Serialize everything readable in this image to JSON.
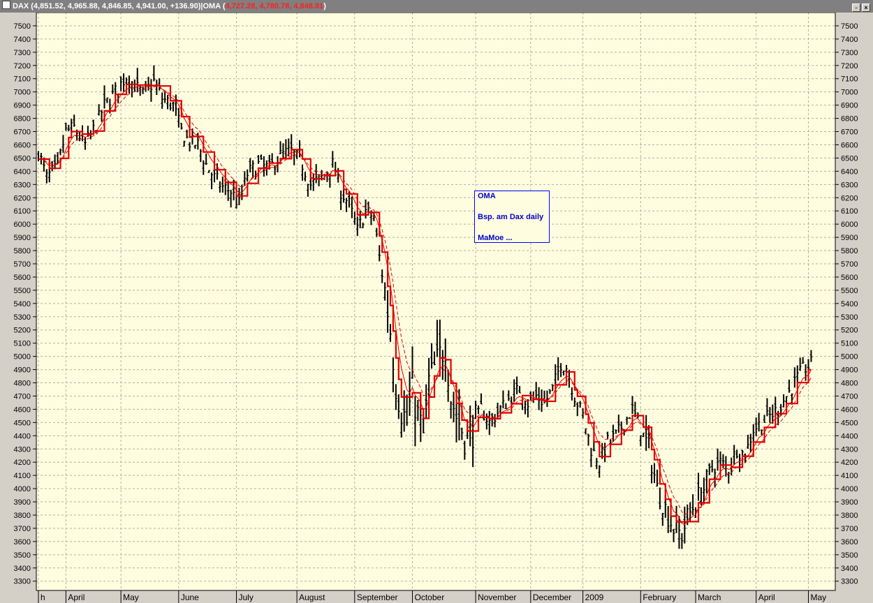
{
  "window": {
    "symbol": "DAX",
    "ohlc": "(4,851.52, 4,965.88, 4,846.85, 4,941.00, +136.90)",
    "indicator_name": "OMA",
    "indicator_open": "(",
    "indicator_values": "4,727.28, 4,780.78, 4,848.81",
    "indicator_close": ")",
    "buttons": [
      "restore",
      "close"
    ]
  },
  "annotation": {
    "line1": "OMA",
    "line2": "Bsp. am Dax daily",
    "line3": "MaMoe ..."
  },
  "colors": {
    "background": "#fffde0",
    "price_bars": "#000000",
    "oma": "#e00000",
    "annotation": "#0000cc"
  },
  "chart_data": {
    "type": "bar",
    "title": "",
    "xlabel": "",
    "ylabel": "",
    "ylim": [
      3230,
      7600
    ],
    "y_ticks": [
      3300,
      3400,
      3500,
      3600,
      3700,
      3800,
      3900,
      4000,
      4100,
      4200,
      4300,
      4400,
      4500,
      4600,
      4700,
      4800,
      4900,
      5000,
      5100,
      5200,
      5300,
      5400,
      5500,
      5600,
      5700,
      5800,
      5900,
      6000,
      6100,
      6200,
      6300,
      6400,
      6500,
      6600,
      6700,
      6800,
      6900,
      7000,
      7100,
      7200,
      7300,
      7400,
      7500
    ],
    "grid": true,
    "y_axis_both_sides": true,
    "month_labels": [
      {
        "label": "h",
        "day": 0
      },
      {
        "label": "April",
        "day": 10
      },
      {
        "label": "May",
        "day": 30
      },
      {
        "label": "June",
        "day": 51
      },
      {
        "label": "July",
        "day": 72
      },
      {
        "label": "August",
        "day": 94
      },
      {
        "label": "September",
        "day": 115
      },
      {
        "label": "October",
        "day": 136
      },
      {
        "label": "November",
        "day": 159
      },
      {
        "label": "December",
        "day": 179
      },
      {
        "label": "2009",
        "day": 198
      },
      {
        "label": "February",
        "day": 219
      },
      {
        "label": "March",
        "day": 239
      },
      {
        "label": "April",
        "day": 261
      },
      {
        "label": "May",
        "day": 280
      }
    ],
    "total_days": 288,
    "price_anchors": [
      [
        0,
        6550
      ],
      [
        3,
        6350
      ],
      [
        7,
        6430
      ],
      [
        10,
        6700
      ],
      [
        13,
        6730
      ],
      [
        17,
        6600
      ],
      [
        21,
        6750
      ],
      [
        24,
        6900
      ],
      [
        28,
        7000
      ],
      [
        32,
        7120
      ],
      [
        35,
        7050
      ],
      [
        38,
        6980
      ],
      [
        42,
        7080
      ],
      [
        45,
        6950
      ],
      [
        49,
        6900
      ],
      [
        52,
        6700
      ],
      [
        55,
        6620
      ],
      [
        58,
        6600
      ],
      [
        61,
        6450
      ],
      [
        64,
        6350
      ],
      [
        67,
        6280
      ],
      [
        70,
        6250
      ],
      [
        73,
        6150
      ],
      [
        76,
        6380
      ],
      [
        80,
        6450
      ],
      [
        84,
        6420
      ],
      [
        88,
        6520
      ],
      [
        92,
        6550
      ],
      [
        96,
        6450
      ],
      [
        99,
        6300
      ],
      [
        103,
        6350
      ],
      [
        107,
        6450
      ],
      [
        110,
        6250
      ],
      [
        113,
        6150
      ],
      [
        116,
        5950
      ],
      [
        119,
        6100
      ],
      [
        122,
        6050
      ],
      [
        124,
        5750
      ],
      [
        126,
        5500
      ],
      [
        128,
        5200
      ],
      [
        130,
        4800
      ],
      [
        132,
        4600
      ],
      [
        134,
        4500
      ],
      [
        136,
        4750
      ],
      [
        138,
        4550
      ],
      [
        140,
        4400
      ],
      [
        142,
        4800
      ],
      [
        145,
        4950
      ],
      [
        148,
        5100
      ],
      [
        150,
        4700
      ],
      [
        152,
        4550
      ],
      [
        155,
        4400
      ],
      [
        158,
        4450
      ],
      [
        161,
        4600
      ],
      [
        164,
        4500
      ],
      [
        168,
        4600
      ],
      [
        172,
        4700
      ],
      [
        175,
        4750
      ],
      [
        178,
        4650
      ],
      [
        181,
        4700
      ],
      [
        184,
        4650
      ],
      [
        187,
        4750
      ],
      [
        190,
        4950
      ],
      [
        192,
        4920
      ],
      [
        195,
        4700
      ],
      [
        198,
        4550
      ],
      [
        201,
        4300
      ],
      [
        204,
        4200
      ],
      [
        207,
        4350
      ],
      [
        210,
        4400
      ],
      [
        213,
        4500
      ],
      [
        216,
        4600
      ],
      [
        219,
        4450
      ],
      [
        222,
        4300
      ],
      [
        225,
        4000
      ],
      [
        228,
        3850
      ],
      [
        231,
        3700
      ],
      [
        234,
        3650
      ],
      [
        236,
        3780
      ],
      [
        239,
        3900
      ],
      [
        242,
        4000
      ],
      [
        245,
        4150
      ],
      [
        248,
        4200
      ],
      [
        251,
        4150
      ],
      [
        254,
        4300
      ],
      [
        257,
        4250
      ],
      [
        260,
        4450
      ],
      [
        263,
        4500
      ],
      [
        266,
        4550
      ],
      [
        269,
        4600
      ],
      [
        272,
        4700
      ],
      [
        275,
        4800
      ],
      [
        278,
        4900
      ],
      [
        281,
        4941
      ]
    ],
    "series": [
      {
        "name": "DAX",
        "style": "ohlc-bars"
      },
      {
        "name": "OMA",
        "style": "step-line",
        "value": 4848.81
      },
      {
        "name": "OMA",
        "style": "thin-line",
        "value": 4780.78
      },
      {
        "name": "OMA",
        "style": "dashed-line",
        "value": 4727.28
      }
    ]
  }
}
